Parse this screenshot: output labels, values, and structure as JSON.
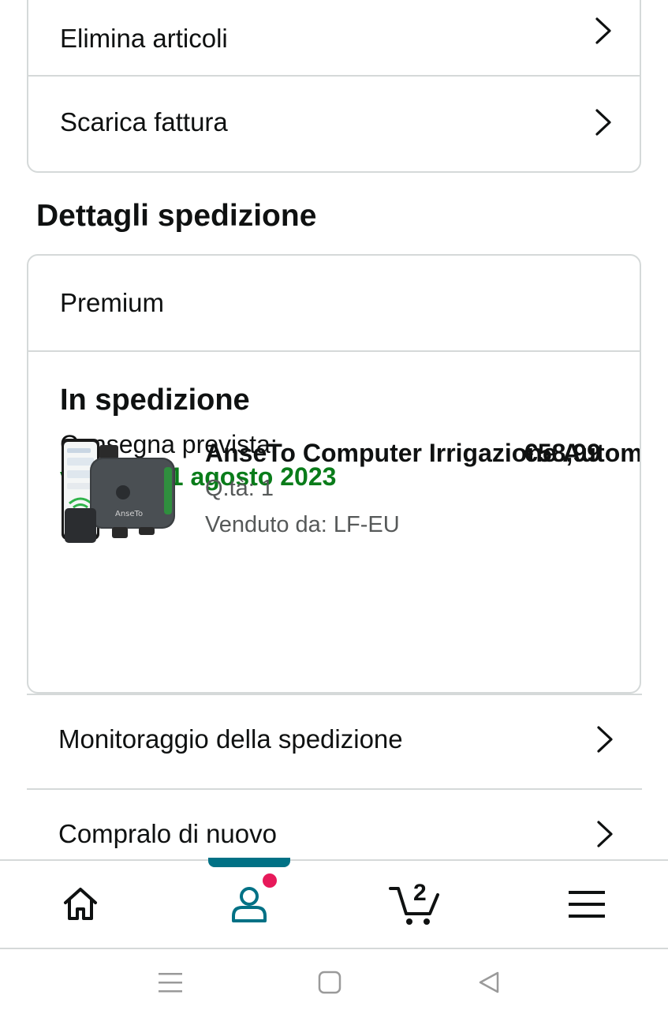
{
  "actions": {
    "delete_items": "Elimina articoli",
    "download_invoice": "Scarica fattura"
  },
  "shipping": {
    "section_title": "Dettagli spedizione",
    "service": "Premium",
    "status": "In spedizione",
    "delivery_label": "Consegna prevista:",
    "delivery_date": "venerdì 11 agosto 2023",
    "product": {
      "title": "AnseTo Computer Irrigazione Automatico",
      "price": "€58,99",
      "quantity": "Q.tà: 1",
      "seller": "Venduto da: LF-EU",
      "image_brand": "AnseTo"
    },
    "track_label": "Monitoraggio della spedizione",
    "buy_again_label": "Compralo di nuovo"
  },
  "nav": {
    "items": [
      {
        "icon": "home-icon"
      },
      {
        "icon": "account-icon",
        "active": true,
        "notification": true
      },
      {
        "icon": "cart-icon",
        "count": "2"
      },
      {
        "icon": "menu-icon"
      }
    ]
  },
  "colors": {
    "delivery_green": "#0a7c1a",
    "active_teal": "#007185",
    "badge_pink": "#e7195a",
    "divider": "#d5d9d9"
  }
}
